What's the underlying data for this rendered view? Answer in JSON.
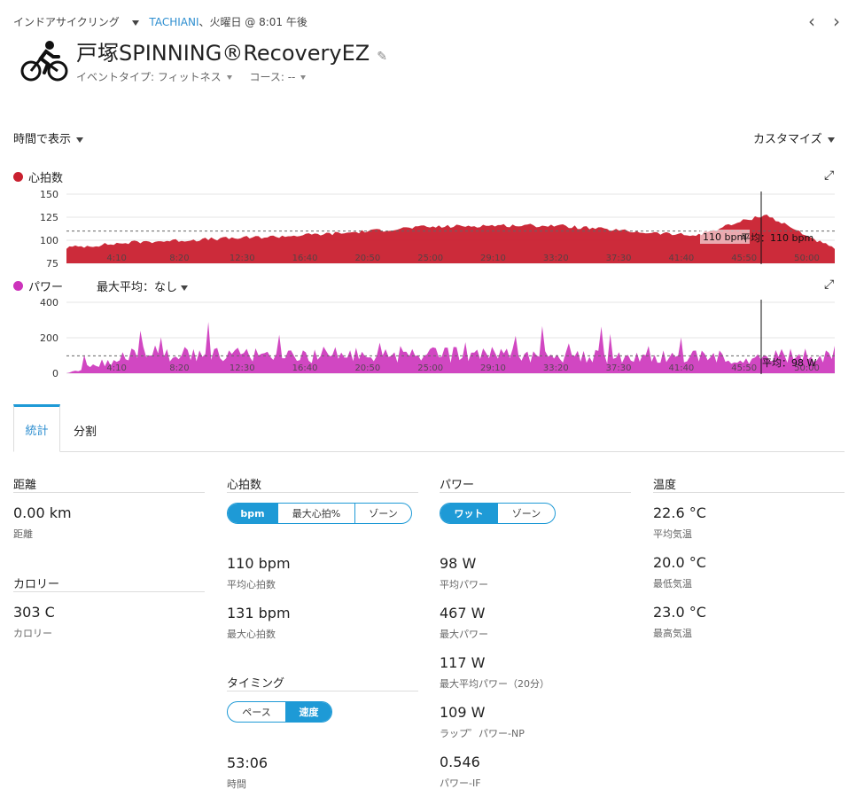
{
  "header": {
    "activity_type": "インドアサイクリング",
    "user": "TACHIANI",
    "datetime": "、火曜日 @ 8:01 午後",
    "title": "戸塚SPINNING®RecoveryEZ",
    "event_type": "イベントタイプ: フィットネス",
    "course": "コース: --"
  },
  "controls": {
    "view_by": "時間で表示",
    "customize": "カスタマイズ"
  },
  "colors": {
    "heart": "#c9202f",
    "power": "#cc33bb",
    "accent": "#1e9ad6"
  },
  "hr_chart": {
    "label": "心拍数",
    "avg_label": "平均：110 bpm",
    "marker_value": "110 bpm"
  },
  "power_chart": {
    "label": "パワー",
    "max_avg_label": "最大平均：なし",
    "avg_label": "平均：98 W"
  },
  "chart_data": [
    {
      "type": "area",
      "name": "心拍数",
      "x": [
        "4:10",
        "8:20",
        "12:30",
        "16:40",
        "20:50",
        "25:00",
        "29:10",
        "33:20",
        "37:30",
        "41:40",
        "45:50",
        "50:00"
      ],
      "values": [
        92,
        98,
        101,
        104,
        108,
        114,
        116,
        116,
        110,
        105,
        128,
        90
      ],
      "yticks": [
        75,
        100,
        125,
        150
      ],
      "ylim": [
        75,
        150
      ],
      "average": 110
    },
    {
      "type": "area",
      "name": "パワー",
      "x": [
        "4:10",
        "8:20",
        "12:30",
        "16:40",
        "20:50",
        "25:00",
        "29:10",
        "33:20",
        "37:30",
        "41:40",
        "45:50",
        "50:00"
      ],
      "values": [
        0,
        110,
        105,
        100,
        105,
        100,
        105,
        95,
        90,
        90,
        95,
        98
      ],
      "yticks": [
        0,
        200,
        400
      ],
      "ylim": [
        0,
        400
      ],
      "average": 98
    }
  ],
  "tabs": {
    "stats": "統計",
    "splits": "分割"
  },
  "distance": {
    "title": "距離",
    "value": "0.00 km",
    "label": "距離"
  },
  "calories": {
    "title": "カロリー",
    "value": "303 C",
    "label": "カロリー"
  },
  "heart_rate": {
    "title": "心拍数",
    "toggle": [
      "bpm",
      "最大心拍%",
      "ゾーン"
    ],
    "avg_value": "110 bpm",
    "avg_label": "平均心拍数",
    "max_value": "131 bpm",
    "max_label": "最大心拍数"
  },
  "timing": {
    "title": "タイミング",
    "toggle": [
      "ペース",
      "速度"
    ],
    "time_value": "53:06",
    "time_label": "時間"
  },
  "power": {
    "title": "パワー",
    "toggle": [
      "ワット",
      "ゾーン"
    ],
    "items": [
      {
        "value": "98 W",
        "label": "平均パワー"
      },
      {
        "value": "467 W",
        "label": "最大パワー"
      },
      {
        "value": "117 W",
        "label": "最大平均パワー（20分）"
      },
      {
        "value": "109 W",
        "label": "ラップ゜パワー-NP"
      },
      {
        "value": "0.546",
        "label": "パワー-IF"
      }
    ]
  },
  "temperature": {
    "title": "温度",
    "items": [
      {
        "value": "22.6 °C",
        "label": "平均気温"
      },
      {
        "value": "20.0 °C",
        "label": "最低気温"
      },
      {
        "value": "23.0 °C",
        "label": "最高気温"
      }
    ]
  }
}
